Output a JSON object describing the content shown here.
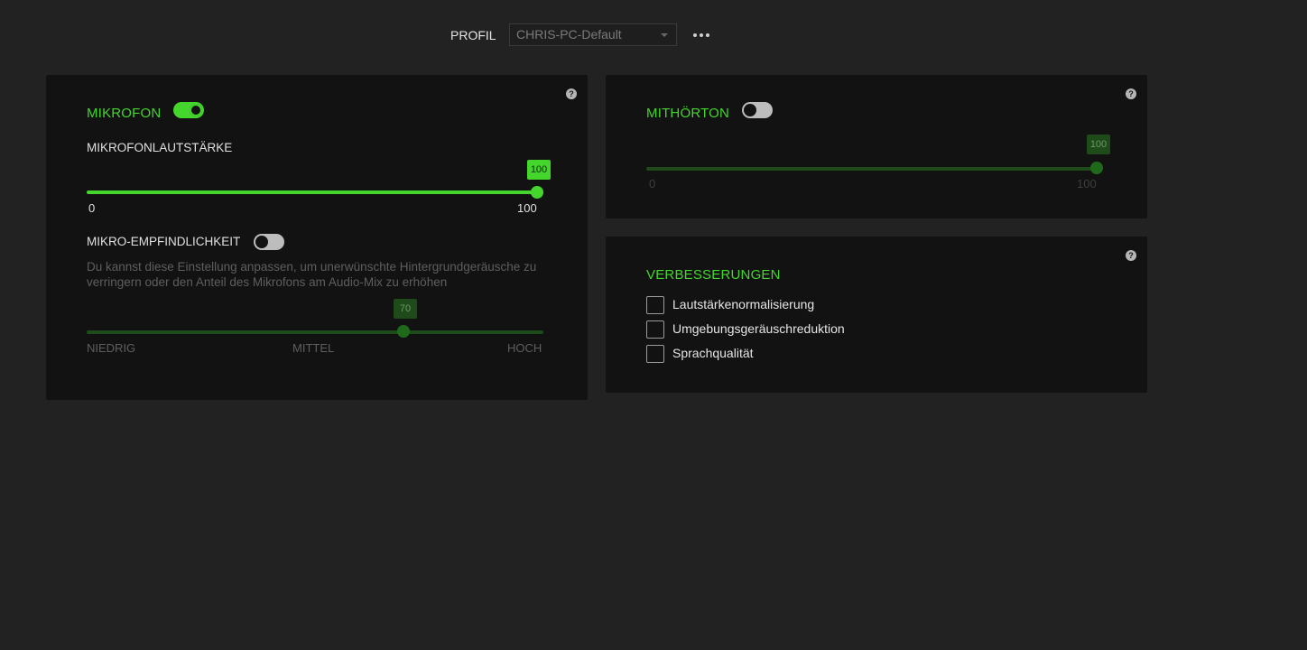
{
  "profile": {
    "label": "PROFIL",
    "selected": "CHRIS-PC-Default"
  },
  "microphone": {
    "title": "MIKROFON",
    "enabled": true,
    "volume_label": "MIKROFONLAUTSTÄRKE",
    "volume": {
      "value": "100",
      "min_label": "0",
      "max_label": "100",
      "fraction": 1.0
    },
    "sensitivity_label": "MIKRO-EMPFINDLICHKEIT",
    "sensitivity_enabled": false,
    "sensitivity_desc": "Du kannst diese Einstellung anpassen, um unerwünschte Hintergrundgeräusche zu verringern oder den Anteil des Mikrofons am Audio-Mix zu erhöhen",
    "sensitivity": {
      "value": "70",
      "fraction": 0.7,
      "low_label": "NIEDRIG",
      "mid_label": "MITTEL",
      "high_label": "HOCH"
    }
  },
  "sidetone": {
    "title": "MITHÖRTON",
    "enabled": false,
    "slider": {
      "value": "100",
      "min_label": "0",
      "max_label": "100",
      "fraction": 1.0
    }
  },
  "enhancements": {
    "title": "VERBESSERUNGEN",
    "items": [
      {
        "label": "Lautstärkenormalisierung",
        "checked": false
      },
      {
        "label": "Umgebungsgeräuschreduktion",
        "checked": false
      },
      {
        "label": "Sprachqualität",
        "checked": false
      }
    ]
  },
  "colors": {
    "accent": "#44d62c",
    "accent_dim": "#1f4a1a",
    "panel": "#121212",
    "background": "#222222"
  }
}
